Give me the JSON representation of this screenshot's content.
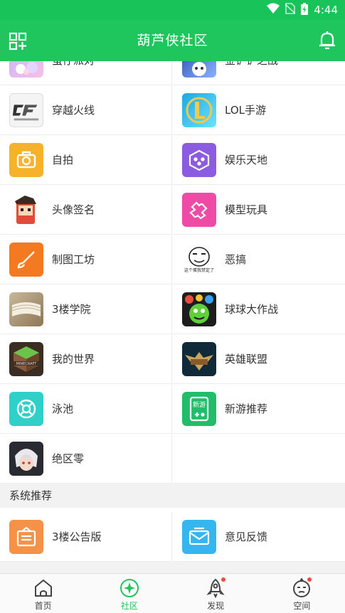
{
  "status_bar": {
    "time": "4:44"
  },
  "app_bar": {
    "title": "葫芦侠社区"
  },
  "grid_rows": [
    {
      "left": {
        "label": "萤仔派对",
        "icon": "party-game-icon"
      },
      "right": {
        "label": "金铲铲之战",
        "icon": "golden-spatula-icon"
      }
    },
    {
      "left": {
        "label": "穿越火线",
        "icon": "crossfire-icon"
      },
      "right": {
        "label": "LOL手游",
        "icon": "lol-icon"
      }
    },
    {
      "left": {
        "label": "自拍",
        "icon": "camera-icon"
      },
      "right": {
        "label": "娱乐天地",
        "icon": "dice-icon"
      }
    },
    {
      "left": {
        "label": "头像签名",
        "icon": "avatar-character-icon"
      },
      "right": {
        "label": "模型玩具",
        "icon": "puzzle-icon"
      }
    },
    {
      "left": {
        "label": "制图工坊",
        "icon": "brush-icon"
      },
      "right": {
        "label": "恶搞",
        "icon": "meme-face-icon"
      }
    },
    {
      "left": {
        "label": "3楼学院",
        "icon": "book-icon"
      },
      "right": {
        "label": "球球大作战",
        "icon": "ball-battle-icon"
      }
    },
    {
      "left": {
        "label": "我的世界",
        "icon": "minecraft-icon"
      },
      "right": {
        "label": "英雄联盟",
        "icon": "league-of-legends-icon"
      }
    },
    {
      "left": {
        "label": "泳池",
        "icon": "lifebuoy-icon"
      },
      "right": {
        "label": "新游推荐",
        "icon": "new-game-icon"
      }
    },
    {
      "left": {
        "label": "绝区零",
        "icon": "zenless-zone-zero-icon"
      },
      "right": null
    }
  ],
  "meme_caption": "这个蛋我禁定了",
  "new_game_badge": "新游",
  "section": {
    "title": "系统推荐"
  },
  "system_rows": [
    {
      "left": {
        "label": "3楼公告版",
        "icon": "announcement-icon"
      },
      "right": {
        "label": "意见反馈",
        "icon": "feedback-mail-icon"
      }
    }
  ],
  "bottom_nav": [
    {
      "label": "首页",
      "icon": "home-icon",
      "active": false,
      "dot": false
    },
    {
      "label": "社区",
      "icon": "community-icon",
      "active": true,
      "dot": false
    },
    {
      "label": "发现",
      "icon": "rocket-icon",
      "active": false,
      "dot": true
    },
    {
      "label": "空间",
      "icon": "profile-face-icon",
      "active": false,
      "dot": true
    }
  ],
  "colors": {
    "brand_green": "#1ec65d",
    "badge_red": "#f24a3d"
  }
}
